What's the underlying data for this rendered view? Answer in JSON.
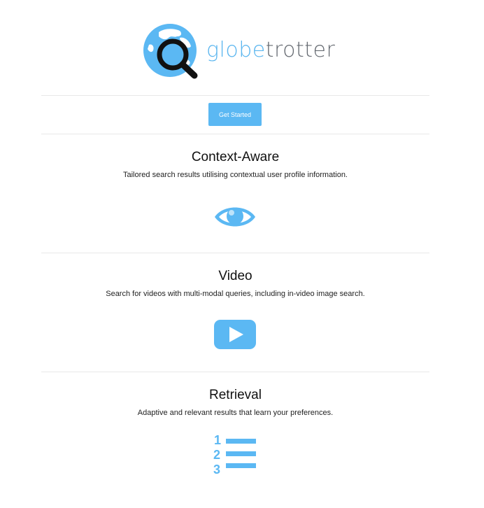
{
  "brand": {
    "wordmark_part1": "globe",
    "wordmark_part2": "trotter",
    "accent_color": "#5bb8f3",
    "logo_icon": "globe-magnifier-icon"
  },
  "cta": {
    "label": "Get Started"
  },
  "features": [
    {
      "title": "Context-Aware",
      "description": "Tailored search results utilising contextual user profile information.",
      "icon": "eye-icon"
    },
    {
      "title": "Video",
      "description": "Search for videos with multi-modal queries, including in-video image search.",
      "icon": "play-video-icon"
    },
    {
      "title": "Retrieval",
      "description": "Adaptive and relevant results that learn your preferences.",
      "icon": "numbered-list-icon"
    }
  ]
}
